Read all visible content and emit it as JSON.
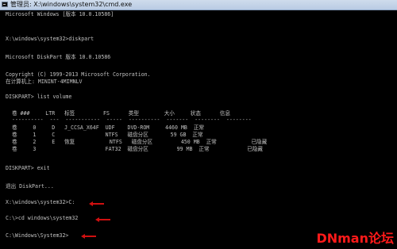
{
  "window": {
    "title": "管理员: X:\\windows\\system32\\cmd.exe"
  },
  "console": {
    "lines": [
      "Microsoft Windows [版本 10.0.10586]",
      "",
      "X:\\windows\\system32>diskpart",
      "",
      "Microsoft DiskPart 版本 10.0.10586",
      "",
      "Copyright (C) 1999-2013 Microsoft Corporation.",
      "在计算机上: MININT-4MIMNLV",
      "",
      "DISKPART> list volume",
      "",
      "  卷 ###     LTR   标签         FS      类型        大小     状态      信息",
      "  ----------  ---  -----------  -----  ----------  -------  --------  --------",
      "  卷     0     D   J_CCSA_X64F  UDF    DVD-ROM     4460 MB  正常",
      "  卷     1     C                NTFS   磁盘分区       59 GB  正常",
      "  卷     2     E   恢复           NTFS   磁盘分区         450 MB  正常           已隐藏",
      "  卷     3                      FAT32  磁盘分区         99 MB  正常            已隐藏",
      "",
      "DISKPART> exit",
      "",
      "退出 DiskPart...",
      "",
      "X:\\windows\\system32>C:",
      "",
      "C:\\>cd windows\\system32",
      "",
      "C:\\Windows\\System32>"
    ]
  },
  "watermark": {
    "text": "DNman论坛"
  },
  "colors": {
    "console_bg": "#000000",
    "console_text": "#c0c0c0",
    "arrow": "#d01010",
    "watermark": "#ff1a1a"
  }
}
